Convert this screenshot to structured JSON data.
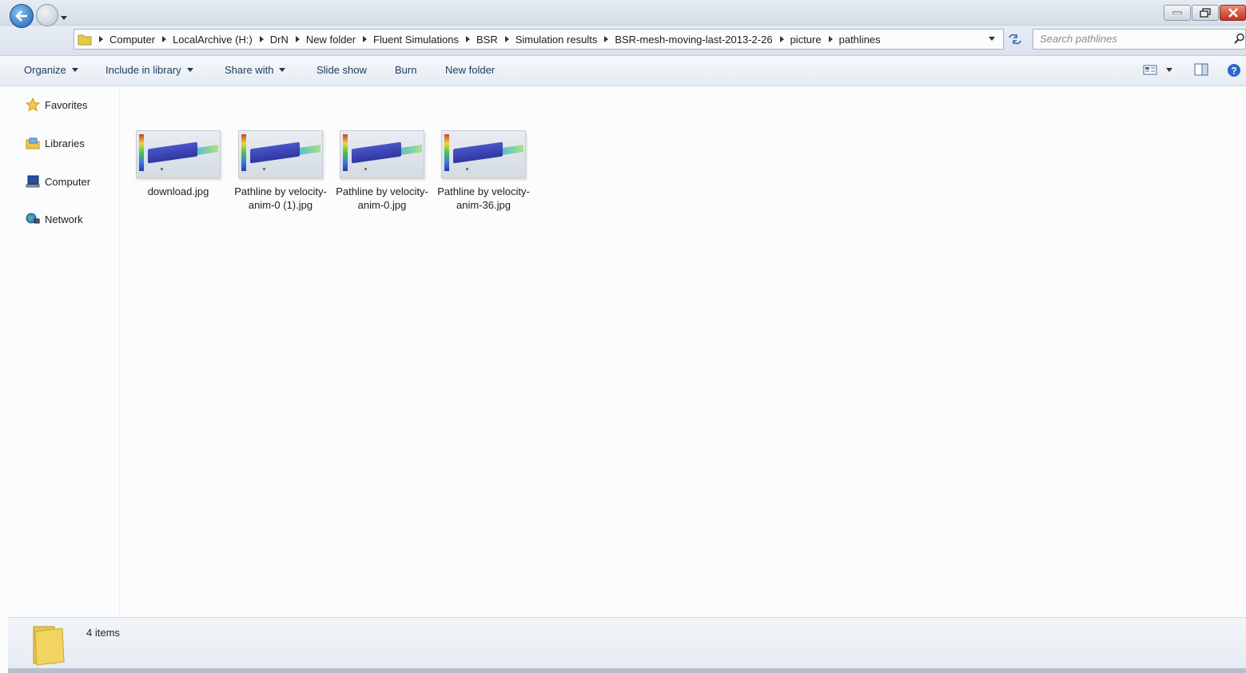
{
  "address_bar": {
    "crumbs": [
      "Computer",
      "LocalArchive (H:)",
      "DrN",
      "New folder",
      "Fluent Simulations",
      "BSR",
      "Simulation results",
      "BSR-mesh-moving-last-2013-2-26",
      "picture",
      "pathlines"
    ]
  },
  "search": {
    "placeholder": "Search pathlines"
  },
  "toolbar": {
    "organize": "Organize",
    "include_in_library": "Include in library",
    "share_with": "Share with",
    "slide_show": "Slide show",
    "burn": "Burn",
    "new_folder": "New folder"
  },
  "sidebar": {
    "items": [
      {
        "label": "Favorites",
        "icon": "star-icon"
      },
      {
        "label": "Libraries",
        "icon": "libraries-icon"
      },
      {
        "label": "Computer",
        "icon": "computer-icon"
      },
      {
        "label": "Network",
        "icon": "network-icon"
      }
    ]
  },
  "files": [
    {
      "name": "download.jpg"
    },
    {
      "name": "Pathline by velocity-anim-0 (1).jpg"
    },
    {
      "name": "Pathline by velocity-anim-0.jpg"
    },
    {
      "name": "Pathline by velocity-anim-36.jpg"
    }
  ],
  "status": {
    "count": "4 items"
  },
  "colors": {
    "accent": "#1c5fb0",
    "toolbar_text": "#1e395b",
    "close": "#c4321d"
  }
}
